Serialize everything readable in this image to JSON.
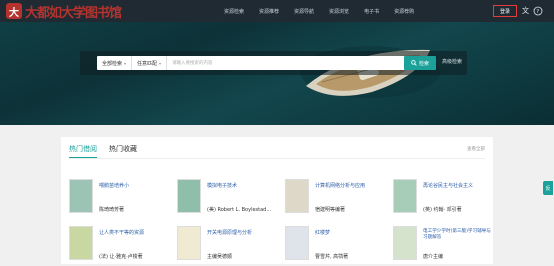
{
  "header": {
    "logo_text": "大都如大学图书馆",
    "menu": [
      "资源检索",
      "资源推荐",
      "资源导航",
      "资源浏览",
      "电子书",
      "资源荐购"
    ],
    "login_label": "登录",
    "colors": {
      "bg": "#1f2a33",
      "accent": "#e23c3c"
    }
  },
  "search": {
    "scope": "全部检索",
    "match": "任意匹配",
    "placeholder": "请输入要搜索的内容",
    "button_label": "检索",
    "advanced_label": "高级检索",
    "accent": "#1aa19a"
  },
  "panel": {
    "tabs": [
      "热门借阅",
      "热门收藏"
    ],
    "view_all": "查看全部",
    "books": [
      {
        "title": "喂鹅苗培养小",
        "author": "陈琦琦芳著",
        "cover": "#9cc4b4"
      },
      {
        "title": "模拟电子技术",
        "author": "(美) Robert L. Boylestad...",
        "cover": "#8fbfab"
      },
      {
        "title": "计算机网络分析与应用",
        "author": "宿建明等编著",
        "cover": "#ddd8c8"
      },
      {
        "title": "再论谷民主与社会主义",
        "author": "(英) 约翰· 邓引著",
        "cover": "#a7cdb9"
      },
      {
        "title": "让人类不干等的资源",
        "author": "(法) 让·雅克·卢梭著",
        "cover": "#c9d8a3"
      },
      {
        "title": "开关电源原理与分析",
        "author": "主编吴德顺",
        "cover": "#f1ead2"
      },
      {
        "title": "红楼梦",
        "author": "曹雪芹, 高鹗著",
        "cover": "#dfe3ea"
      },
      {
        "title": "电工学少学时(第三版)学习辅导与习题解答",
        "author": "唐介主编",
        "cover": "#d5e3cd"
      }
    ]
  },
  "side_tab_label": "反"
}
